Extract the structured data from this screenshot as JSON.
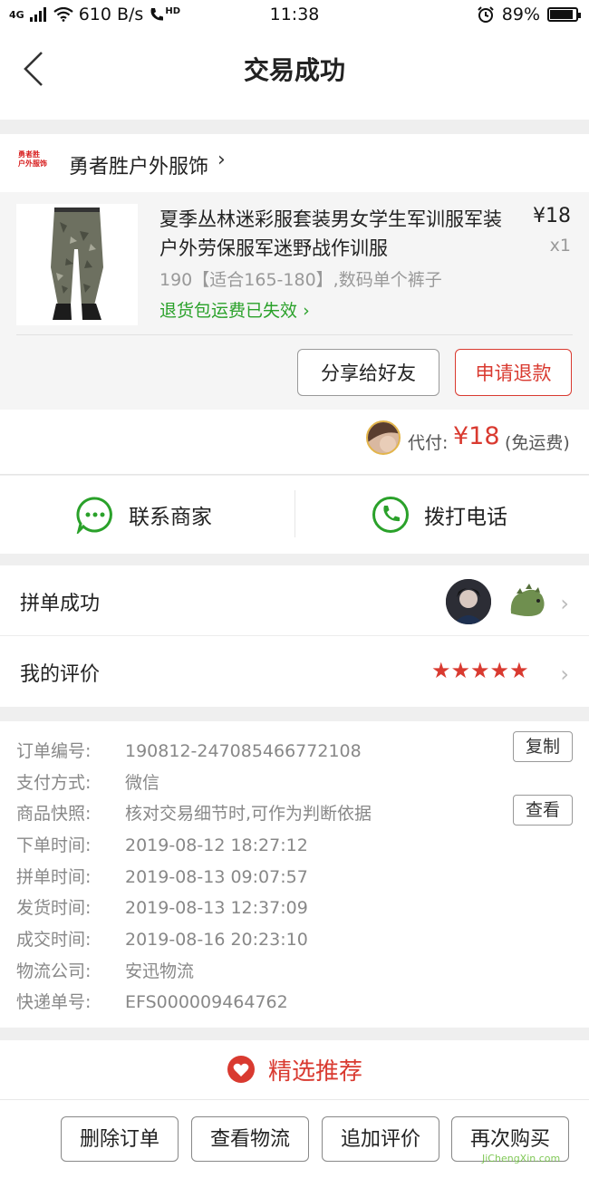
{
  "status": {
    "network": "4G",
    "speed": "610 B/s",
    "hd": "HD",
    "time": "11:38",
    "battery": "89%",
    "battery_level": 0.89
  },
  "nav": {
    "title": "交易成功"
  },
  "shop": {
    "logo_text_line1": "勇者胜",
    "logo_text_line2": "户外服饰",
    "name": "勇者胜户外服饰"
  },
  "product": {
    "title": "夏季丛林迷彩服套装男女学生军训服军装户外劳保服军迷野战作训服",
    "price": "¥18",
    "qty": "x1",
    "spec": "190【适合165-180】,数码单个裤子",
    "return_fee": "退货包运费已失效",
    "share_button": "分享给好友",
    "refund_button": "申请退款"
  },
  "payment": {
    "label": "代付:",
    "amount": "¥18",
    "note": "(免运费)"
  },
  "contact": {
    "merchant": "联系商家",
    "call": "拨打电话"
  },
  "group_row": {
    "label": "拼单成功"
  },
  "review_row": {
    "label": "我的评价",
    "stars": 5
  },
  "order": {
    "items": [
      {
        "key": "订单编号:",
        "value": "190812-247085466772108"
      },
      {
        "key": "支付方式:",
        "value": "微信"
      },
      {
        "key": "商品快照:",
        "value": "核对交易细节时,可作为判断依据"
      },
      {
        "key": "下单时间:",
        "value": "2019-08-12 18:27:12"
      },
      {
        "key": "拼单时间:",
        "value": "2019-08-13 09:07:57"
      },
      {
        "key": "发货时间:",
        "value": "2019-08-13 12:37:09"
      },
      {
        "key": "成交时间:",
        "value": "2019-08-16 20:23:10"
      },
      {
        "key": "物流公司:",
        "value": "安迅物流"
      },
      {
        "key": "快递单号:",
        "value": "EFS000009464762"
      }
    ],
    "copy_button": "复制",
    "view_button": "查看"
  },
  "recommend": {
    "label": "精选推荐"
  },
  "bottom": {
    "delete": "删除订单",
    "logistics": "查看物流",
    "add_review": "追加评价",
    "rebuy": "再次购买"
  },
  "watermark": {
    "text": "JiChengXin.com"
  },
  "colors": {
    "accent": "#d93a30",
    "green": "#2aa12a"
  }
}
